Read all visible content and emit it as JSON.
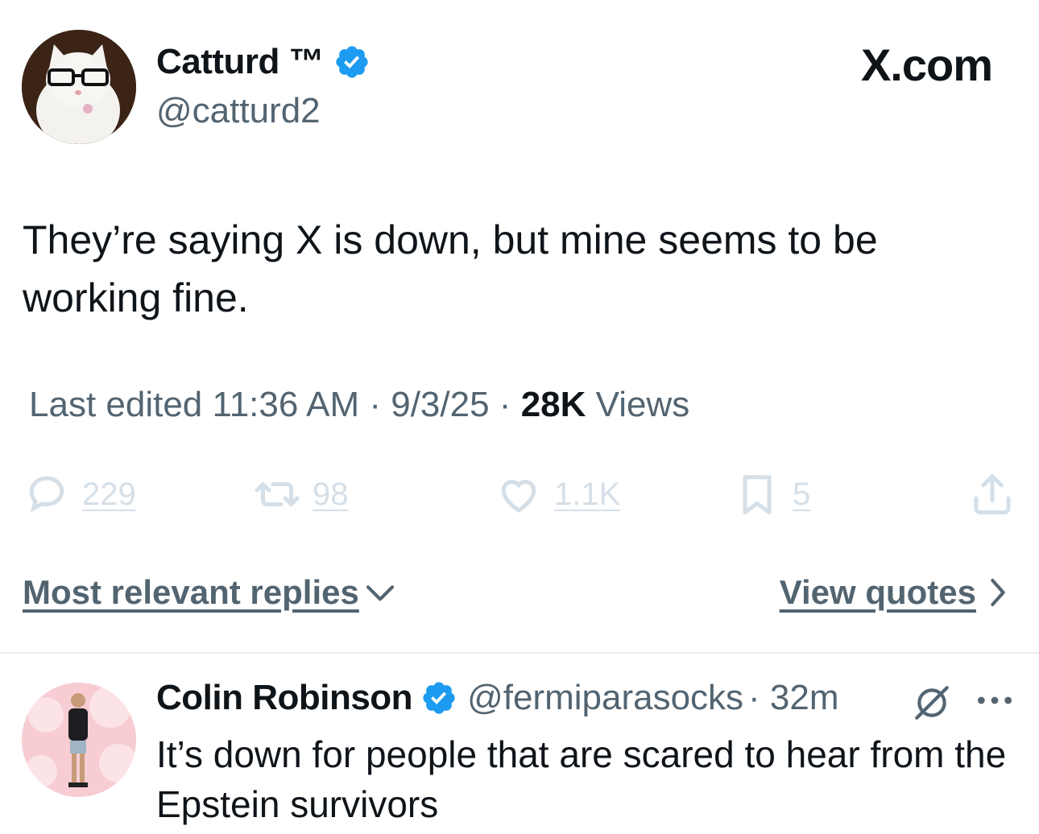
{
  "header": {
    "author_name": "Catturd ™",
    "author_handle": "@catturd2",
    "brand": "X.com",
    "verified_icon": "verified-badge-icon",
    "verified_color": "#1d9bf0"
  },
  "tweet": {
    "text": "They’re saying X is down, but mine seems to be working fine.",
    "edited_label": "Last edited 11:36 AM · 9/3/25",
    "separator": " · ",
    "views_count": "28K",
    "views_label": "Views"
  },
  "actions": {
    "replies": "229",
    "reposts": "98",
    "likes": "1.1K",
    "bookmarks": "5",
    "icons": [
      "reply-icon",
      "repost-icon",
      "like-icon",
      "bookmark-icon",
      "share-icon"
    ],
    "color": "#d5dfe8"
  },
  "replies_bar": {
    "sort_label": "Most relevant replies",
    "quotes_label": "View quotes"
  },
  "reply": {
    "author_name": "Colin Robinson",
    "author_handle": "@fermiparasocks",
    "time": "· 32m",
    "text": "It’s down for people that are scared to hear from the Epstein survivors"
  },
  "colors": {
    "text_primary": "#0f1419",
    "text_secondary": "#536471",
    "divider": "#e7eaec"
  }
}
